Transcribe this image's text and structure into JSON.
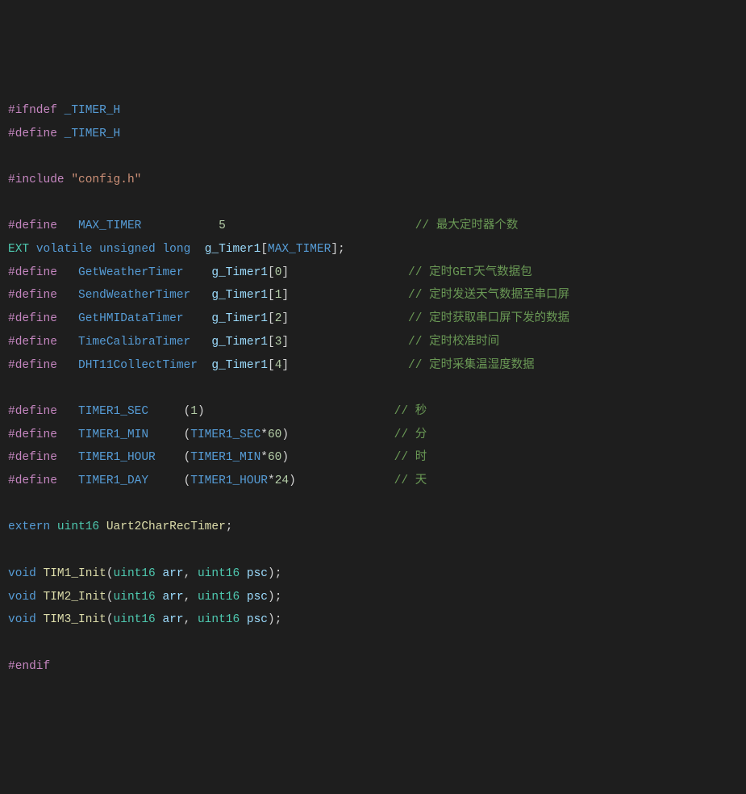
{
  "lines": {
    "l1_pp": "#ifndef",
    "l1_id": "_TIMER_H",
    "l2_pp": "#define",
    "l2_id": "_TIMER_H",
    "l4_pp": "#include",
    "l4_str": "\"config.h\"",
    "l6_pp": "#define",
    "l6_id": "MAX_TIMER",
    "l6_val": "5",
    "l6_cmt": "// 最大定时器个数",
    "l7_ext": "EXT",
    "l7_vol": "volatile",
    "l7_uns": "unsigned",
    "l7_long": "long",
    "l7_var": "g_Timer1",
    "l7_mac": "MAX_TIMER",
    "l8_pp": "#define",
    "l8_id": "GetWeatherTimer",
    "l8_arr": "g_Timer1",
    "l8_idx": "0",
    "l8_cmt": "// 定时GET天气数据包",
    "l9_pp": "#define",
    "l9_id": "SendWeatherTimer",
    "l9_arr": "g_Timer1",
    "l9_idx": "1",
    "l9_cmt": "// 定时发送天气数据至串口屏",
    "l10_pp": "#define",
    "l10_id": "GetHMIDataTimer",
    "l10_arr": "g_Timer1",
    "l10_idx": "2",
    "l10_cmt": "// 定时获取串口屏下发的数据",
    "l11_pp": "#define",
    "l11_id": "TimeCalibraTimer",
    "l11_arr": "g_Timer1",
    "l11_idx": "3",
    "l11_cmt": "// 定时校准时间",
    "l12_pp": "#define",
    "l12_id": "DHT11CollectTimer",
    "l12_arr": "g_Timer1",
    "l12_idx": "4",
    "l12_cmt": "// 定时采集温湿度数据",
    "l14_pp": "#define",
    "l14_id": "TIMER1_SEC",
    "l14_val": "1",
    "l14_cmt": "// 秒",
    "l15_pp": "#define",
    "l15_id": "TIMER1_MIN",
    "l15_a": "TIMER1_SEC",
    "l15_n": "60",
    "l15_cmt": "// 分",
    "l16_pp": "#define",
    "l16_id": "TIMER1_HOUR",
    "l16_a": "TIMER1_MIN",
    "l16_n": "60",
    "l16_cmt": "// 时",
    "l17_pp": "#define",
    "l17_id": "TIMER1_DAY",
    "l17_a": "TIMER1_HOUR",
    "l17_n": "24",
    "l17_cmt": "// 天",
    "l19_kw": "extern",
    "l19_typ": "uint16",
    "l19_var": "Uart2CharRecTimer",
    "l21_void": "void",
    "l21_fn": "TIM1_Init",
    "l21_t1": "uint16",
    "l21_p1": "arr",
    "l21_t2": "uint16",
    "l21_p2": "psc",
    "l22_void": "void",
    "l22_fn": "TIM2_Init",
    "l22_t1": "uint16",
    "l22_p1": "arr",
    "l22_t2": "uint16",
    "l22_p2": "psc",
    "l23_void": "void",
    "l23_fn": "TIM3_Init",
    "l23_t1": "uint16",
    "l23_p1": "arr",
    "l23_t2": "uint16",
    "l23_p2": "psc",
    "l25_pp": "#endif"
  }
}
